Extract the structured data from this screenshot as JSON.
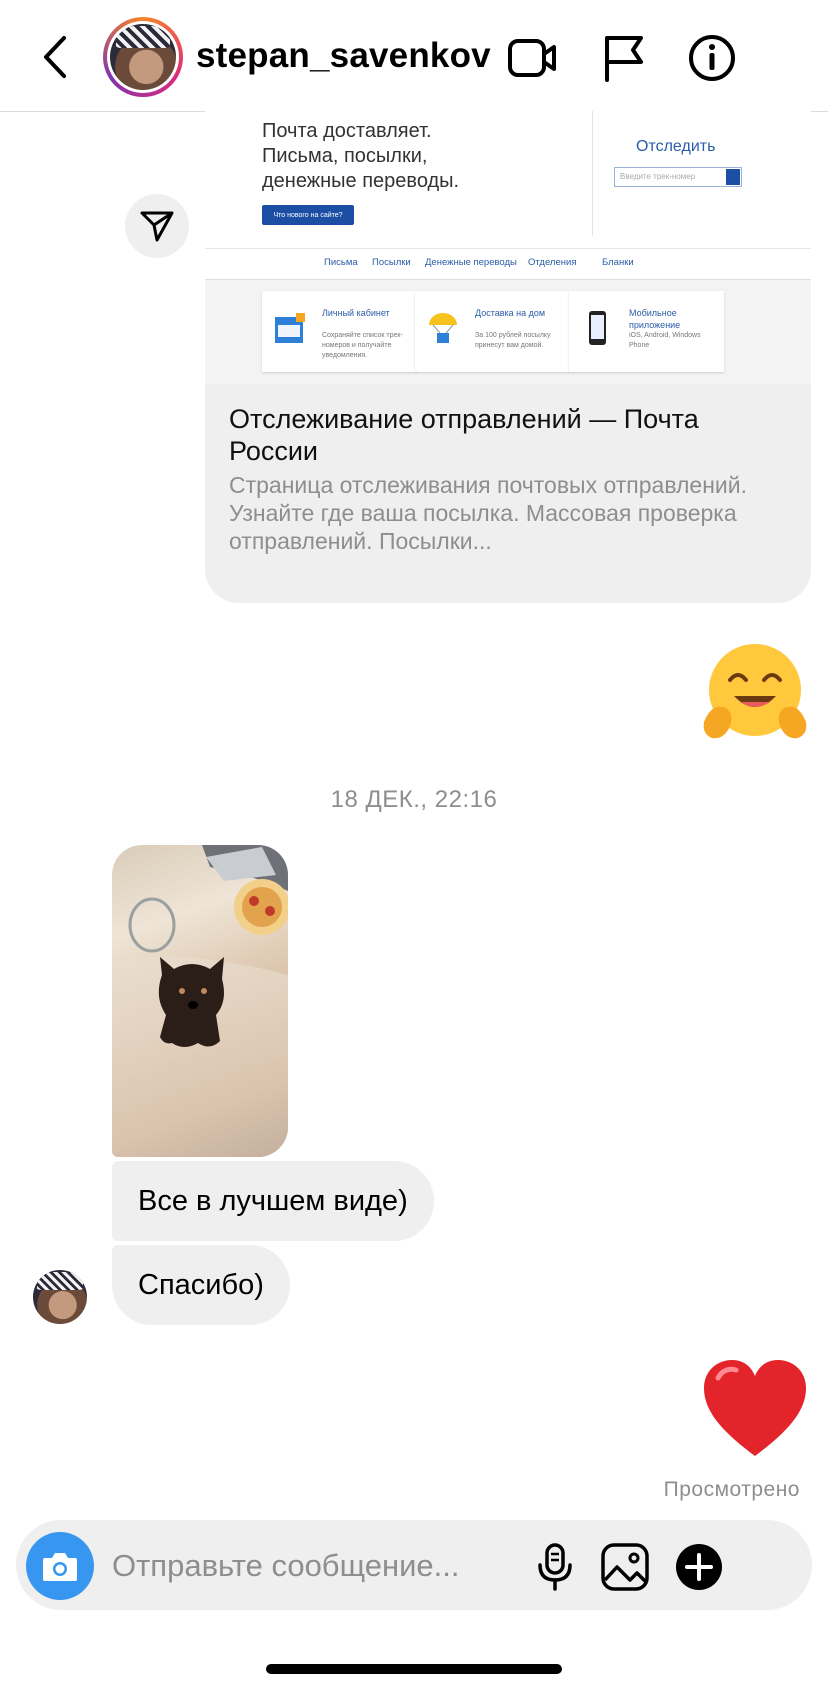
{
  "header": {
    "username": "stepan_savenkov"
  },
  "link_preview": {
    "screenshot": {
      "headline_lines": [
        "Почта доставляет.",
        "Письма, посылки,",
        "денежные переводы."
      ],
      "button_label": "Что нового на сайте?",
      "track_label": "Отследить",
      "track_placeholder": "Введите трек-номер",
      "nav": [
        "Письма",
        "Посылки",
        "Денежные переводы",
        "Отделения",
        "Бланки"
      ],
      "tiles": [
        {
          "title": "Личный кабинет",
          "desc": "Сохраняйте список трек-номеров и получайте уведомления."
        },
        {
          "title": "Доставка на дом",
          "desc": "За 100 рублей посылку принесут вам домой."
        },
        {
          "title": "Мобильное приложение",
          "desc": "iOS, Android, Windows Phone"
        }
      ]
    },
    "title": "Отслеживание отправлений — Почта России",
    "description": "Страница отслеживания почтовых отправлений. Узнайте где ваша посылка. Массовая проверка отправлений. Посылки..."
  },
  "messages": {
    "reaction_emoji": "hugging-face-emoji",
    "timestamp": "18 ДЕК., 22:16",
    "text_1": "Все в лучшем виде)",
    "text_2": "Спасибо)",
    "heart_emoji": "red-heart-emoji",
    "seen_status": "Просмотрено"
  },
  "composer": {
    "placeholder": "Отправьте сообщение..."
  },
  "colors": {
    "accent_blue": "#3797f0",
    "bubble_gray": "#efefef",
    "secondary_text": "#8e8e8e",
    "russian_post_blue": "#1c4ea4"
  }
}
